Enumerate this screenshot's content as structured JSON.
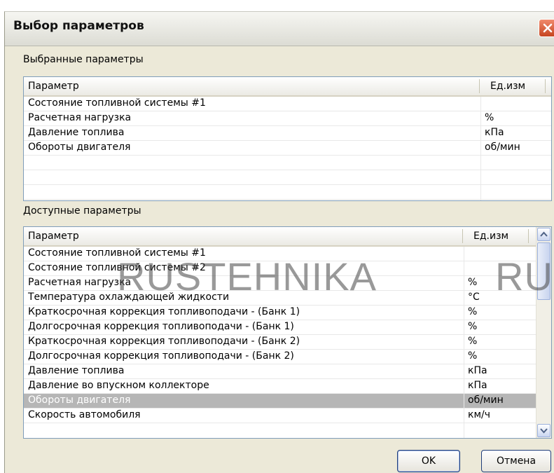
{
  "window": {
    "title": "Выбор параметров"
  },
  "selected": {
    "label": "Выбранные параметры",
    "columns": {
      "name": "Параметр",
      "unit": "Ед.изм"
    },
    "rows": [
      {
        "name": "Состояние топливной системы #1",
        "unit": ""
      },
      {
        "name": "Расчетная нагрузка",
        "unit": "%"
      },
      {
        "name": "Давление топлива",
        "unit": "кПа"
      },
      {
        "name": "Обороты двигателя",
        "unit": "об/мин"
      },
      {
        "name": "",
        "unit": ""
      },
      {
        "name": "",
        "unit": ""
      },
      {
        "name": "",
        "unit": ""
      }
    ]
  },
  "available": {
    "label": "Доступные параметры",
    "columns": {
      "name": "Параметр",
      "unit": "Ед.изм"
    },
    "rows": [
      {
        "name": "Состояние топливной системы #1",
        "unit": ""
      },
      {
        "name": "Состояние топливной системы #2",
        "unit": ""
      },
      {
        "name": "Расчетная нагрузка",
        "unit": "%"
      },
      {
        "name": "Температура охлаждающей жидкости",
        "unit": "°C"
      },
      {
        "name": "Краткосрочная коррекция топливоподачи - (Банк 1)",
        "unit": "%"
      },
      {
        "name": "Долгосрочная коррекция топливоподачи -  (Банк 1)",
        "unit": "%"
      },
      {
        "name": "Краткосрочная коррекция топливоподачи - (Банк 2)",
        "unit": "%"
      },
      {
        "name": "Долгосрочная коррекция топливоподачи -  (Банк 2)",
        "unit": "%"
      },
      {
        "name": "Давление топлива",
        "unit": "кПа"
      },
      {
        "name": "Давление во впускном коллекторе",
        "unit": "кПа"
      },
      {
        "name": "Обороты двигателя",
        "unit": "об/мин"
      },
      {
        "name": "Скорость автомобиля",
        "unit": "км/ч"
      }
    ],
    "selected_index": 10
  },
  "watermark": "RUSTEHNIKA          RU",
  "buttons": {
    "ok": "OK",
    "cancel": "Отмена"
  },
  "icons": {
    "close": "close-icon",
    "scroll_up": "chevron-up-icon",
    "scroll_down": "chevron-down-icon"
  }
}
